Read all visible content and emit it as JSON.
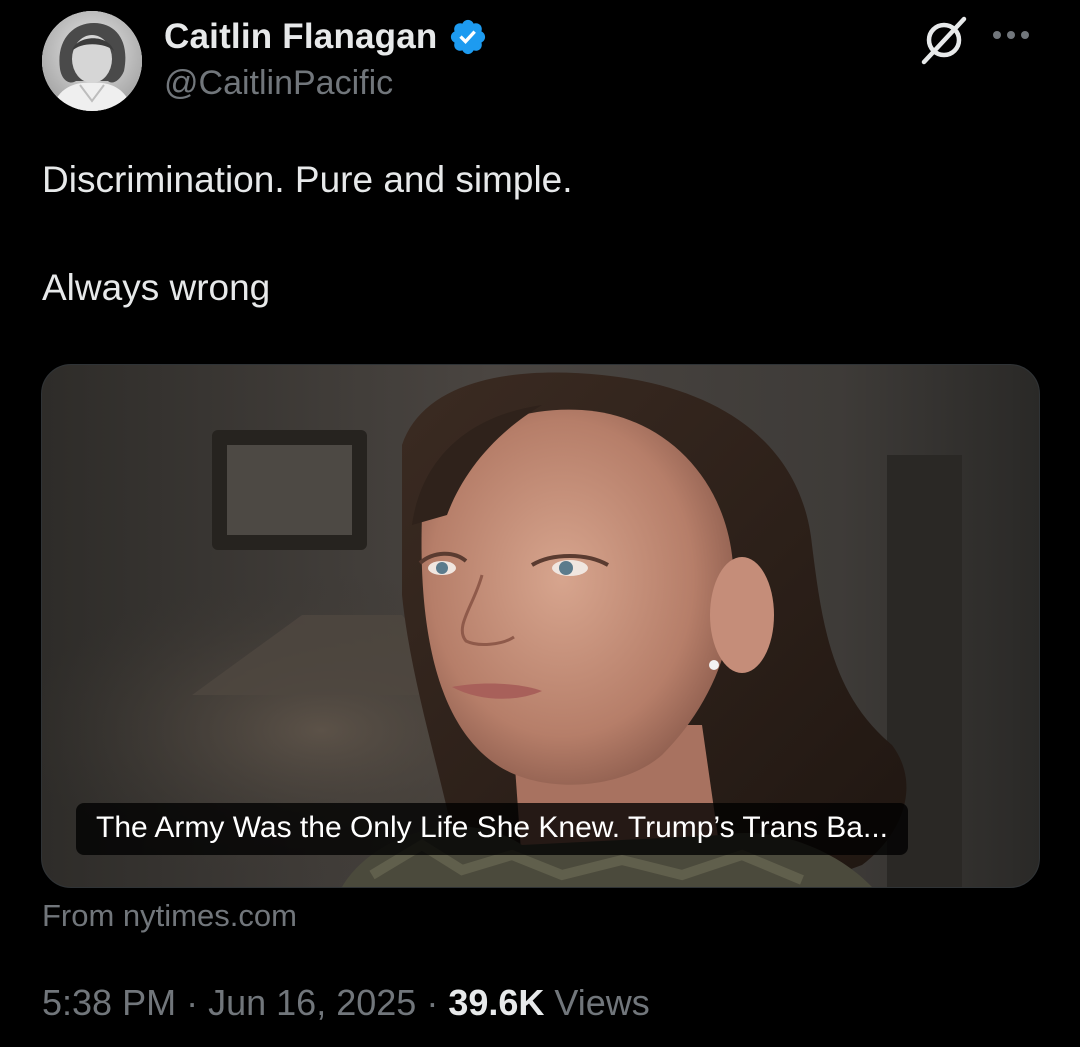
{
  "author": {
    "display_name": "Caitlin Flanagan",
    "handle": "@CaitlinPacific",
    "verified_color": "#1d9bf0"
  },
  "tweet": {
    "lines": [
      "Discrimination. Pure and simple.",
      "Always wrong"
    ]
  },
  "card": {
    "headline": "The Army Was the Only Life She Knew. Trump’s Trans Ba...",
    "source": "From nytimes.com"
  },
  "meta": {
    "time": "5:38 PM",
    "separator": "·",
    "date": "Jun 16, 2025",
    "views_count": "39.6K",
    "views_label": "Views"
  },
  "icons": {
    "verified": "verified-badge-icon",
    "grok": "grok-icon",
    "more": "more-options-icon"
  },
  "colors": {
    "background": "#000000",
    "primary_text": "#e7e9ea",
    "secondary_text": "#71767b",
    "accent": "#1d9bf0"
  }
}
